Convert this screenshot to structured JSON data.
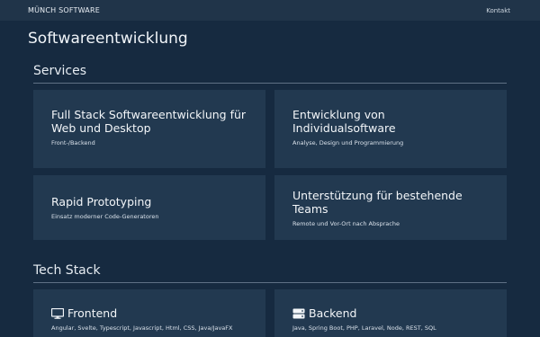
{
  "header": {
    "brand": "MÜNCH SOFTWARE",
    "nav_contact": "Kontakt"
  },
  "page": {
    "title": "Softwareentwicklung"
  },
  "services": {
    "title": "Services",
    "cards": [
      {
        "title": "Full Stack Softwareentwicklung für Web und Desktop",
        "subtitle": "Front-/Backend"
      },
      {
        "title": "Entwicklung von Individualsoftware",
        "subtitle": "Analyse, Design und Programmierung"
      },
      {
        "title": "Rapid Prototyping",
        "subtitle": "Einsatz moderner Code-Generatoren"
      },
      {
        "title": "Unterstützung für bestehende Teams",
        "subtitle": "Remote und Vor-Ort nach Absprache"
      }
    ]
  },
  "tech_stack": {
    "title": "Tech Stack",
    "cards": [
      {
        "icon": "monitor-icon",
        "title": "Frontend",
        "subtitle": "Angular, Svelte, Typescript, Javascript, Html, CSS, Java/JavaFX"
      },
      {
        "icon": "server-icon",
        "title": "Backend",
        "subtitle": "Java, Spring Boot, PHP, Laravel, Node, REST, SQL"
      }
    ]
  },
  "colors": {
    "background": "#162a40",
    "header": "#203449",
    "card": "#223950",
    "text": "#e9eef4"
  }
}
